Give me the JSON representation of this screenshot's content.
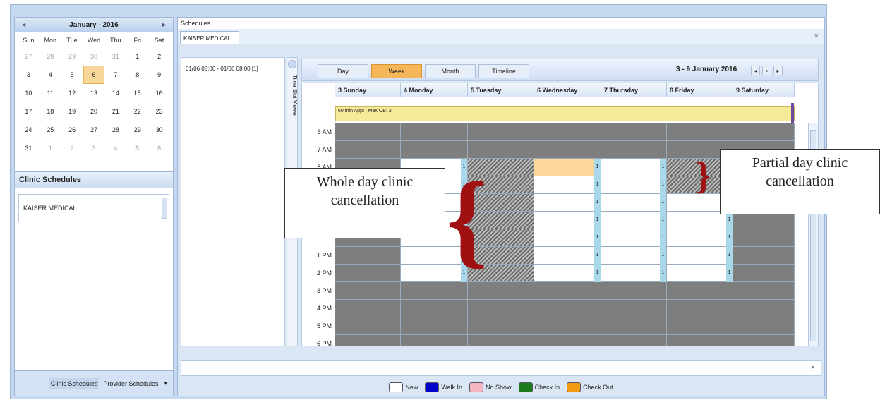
{
  "calendar": {
    "title": "January - 2016",
    "dow": [
      "Sun",
      "Mon",
      "Tue",
      "Wed",
      "Thu",
      "Fri",
      "Sat"
    ],
    "weeks": [
      [
        "27",
        "28",
        "29",
        "30",
        "31",
        "1",
        "2"
      ],
      [
        "3",
        "4",
        "5",
        "6",
        "7",
        "8",
        "9"
      ],
      [
        "10",
        "11",
        "12",
        "13",
        "14",
        "15",
        "16"
      ],
      [
        "17",
        "18",
        "19",
        "20",
        "21",
        "22",
        "23"
      ],
      [
        "24",
        "25",
        "26",
        "27",
        "28",
        "29",
        "30"
      ],
      [
        "31",
        "1",
        "2",
        "3",
        "4",
        "5",
        "6"
      ]
    ],
    "selected": "6"
  },
  "clinic_section": {
    "title": "Clinic Schedules",
    "item": "KAISER MEDICAL"
  },
  "left_footer": {
    "clinic_tab": "Clinic Schedules",
    "provider_tab": "Provider Schedules"
  },
  "schedules": {
    "title": "Schedules",
    "tab": "KAISER MEDICAL",
    "close": "×"
  },
  "slot_panel": {
    "entry": "01/06 08:00 - 01/06 08:00 [1]",
    "viewer_label": "Time Slot Viewer"
  },
  "toolbar": {
    "day": "Day",
    "week": "Week",
    "month": "Month",
    "timeline": "Timeline",
    "range": "3 - 9 January 2016",
    "selected": "week"
  },
  "days": [
    "3 Sunday",
    "4 Monday",
    "5 Tuesday",
    "6 Wednesday",
    "7 Thursday",
    "8 Friday",
    "9 Saturday"
  ],
  "allday_event": "60 min Appt | Max OB: 2",
  "times": [
    "6 AM",
    "7 AM",
    "8 AM",
    "",
    "",
    "",
    "",
    "1 PM",
    "2 PM",
    "3 PM",
    "4 PM",
    "5 PM",
    "6 PM"
  ],
  "slot_count_label": "1",
  "legend": [
    {
      "label": "New",
      "color": "#ffffff"
    },
    {
      "label": "Walk In",
      "color": "#0000cc"
    },
    {
      "label": "No Show",
      "color": "#f4b6c2"
    },
    {
      "label": "Check In",
      "color": "#1b7a1b"
    },
    {
      "label": "Check Out",
      "color": "#f39c12"
    }
  ],
  "annotations": {
    "whole_day": "Whole day clinic cancellation",
    "partial_day": "Partial day clinic cancellation"
  }
}
